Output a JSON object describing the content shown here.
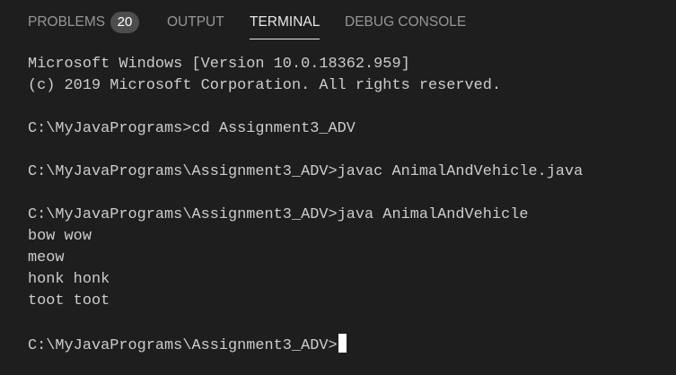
{
  "tabs": {
    "problems": {
      "label": "PROBLEMS",
      "count": "20"
    },
    "output": {
      "label": "OUTPUT"
    },
    "terminal": {
      "label": "TERMINAL"
    },
    "debug_console": {
      "label": "DEBUG CONSOLE"
    },
    "active": "TERMINAL"
  },
  "terminal": {
    "lines": [
      "Microsoft Windows [Version 10.0.18362.959]",
      "(c) 2019 Microsoft Corporation. All rights reserved.",
      "",
      "C:\\MyJavaPrograms>cd Assignment3_ADV",
      "",
      "C:\\MyJavaPrograms\\Assignment3_ADV>javac AnimalAndVehicle.java",
      "",
      "C:\\MyJavaPrograms\\Assignment3_ADV>java AnimalAndVehicle",
      "bow wow",
      "meow",
      "honk honk",
      "toot toot",
      ""
    ],
    "prompt": "C:\\MyJavaPrograms\\Assignment3_ADV>"
  },
  "colors": {
    "background": "#1e1e1e",
    "text": "#cccccc",
    "tab_inactive": "#969696",
    "tab_active": "#e7e7e7",
    "badge_bg": "#4d4d4d",
    "cursor": "#ffffff"
  }
}
